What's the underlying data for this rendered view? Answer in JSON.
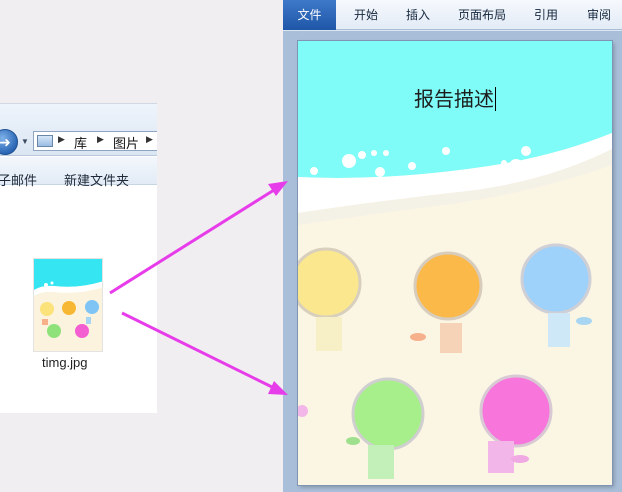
{
  "explorer": {
    "address": {
      "segment_1": "库",
      "segment_2": "图片"
    },
    "toolbar": {
      "email_label": "子邮件",
      "new_folder_label": "新建文件夹"
    },
    "file": {
      "name": "timg.jpg"
    }
  },
  "word": {
    "tabs": [
      "文件",
      "开始",
      "插入",
      "页面布局",
      "引用",
      "审阅"
    ],
    "document": {
      "title": "报告描述"
    }
  },
  "colors": {
    "arrow": "#e73cea",
    "sea": "#7ffbf8",
    "sand": "#fbf5e4",
    "file_tab": "#2a62b4"
  }
}
